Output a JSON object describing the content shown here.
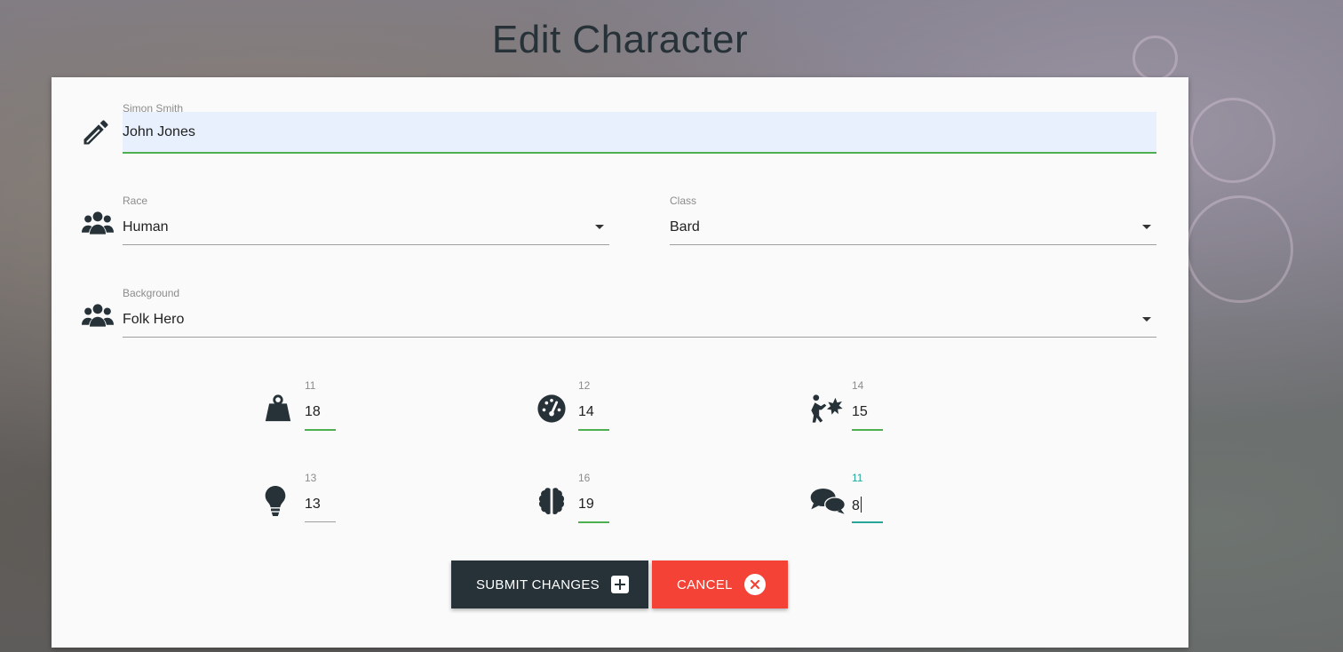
{
  "page": {
    "title": "Edit Character"
  },
  "name_field": {
    "label": "Simon Smith",
    "value": "John Jones"
  },
  "race": {
    "label": "Race",
    "value": "Human"
  },
  "class": {
    "label": "Class",
    "value": "Bard"
  },
  "background": {
    "label": "Background",
    "value": "Folk Hero"
  },
  "stats": {
    "strength": {
      "label": "11",
      "value": "18",
      "icon": "weight-icon"
    },
    "dexterity": {
      "label": "12",
      "value": "14",
      "icon": "tachometer-icon"
    },
    "constitution": {
      "label": "14",
      "value": "15",
      "icon": "user-injured-icon"
    },
    "intelligence": {
      "label": "13",
      "value": "13",
      "icon": "lightbulb-icon"
    },
    "wisdom": {
      "label": "16",
      "value": "19",
      "icon": "brain-icon"
    },
    "charisma": {
      "label": "11",
      "value": "8",
      "icon": "comments-icon"
    }
  },
  "buttons": {
    "submit": {
      "label": "Submit Changes",
      "icon": "plus-square-icon"
    },
    "cancel": {
      "label": "Cancel",
      "icon": "times-circle-icon"
    }
  },
  "colors": {
    "submit_bg": "#263238",
    "cancel_bg": "#f44336",
    "valid_underline": "#4caf50",
    "focus_underline": "#26a69a"
  }
}
